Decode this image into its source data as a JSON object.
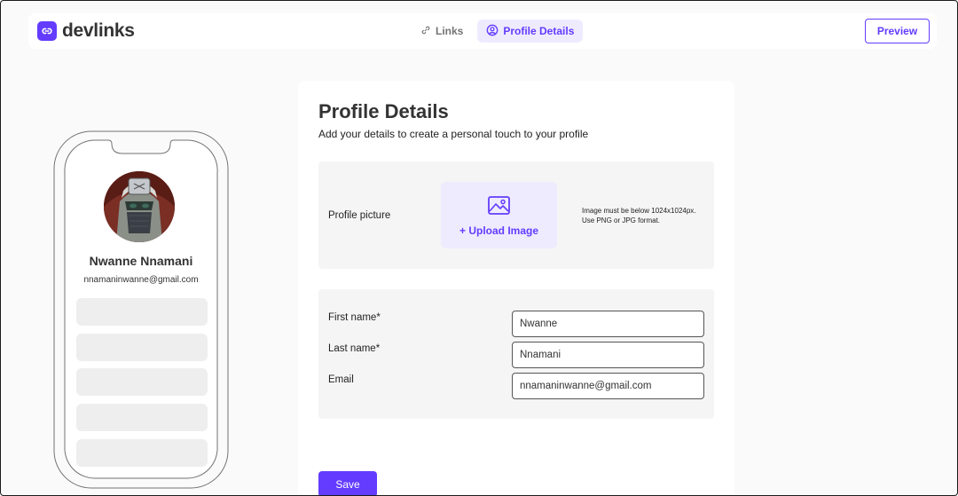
{
  "app": {
    "name": "devlinks",
    "accent": "#633cff",
    "accent_light": "#efebff"
  },
  "nav": {
    "tabs": [
      {
        "label": "Links",
        "icon": "link-icon",
        "active": false
      },
      {
        "label": "Profile Details",
        "icon": "user-circle-icon",
        "active": true
      }
    ],
    "preview_label": "Preview"
  },
  "phone_preview": {
    "name": "Nwanne Nnamani",
    "email": "nnamaninwanne@gmail.com",
    "link_placeholders": 5
  },
  "profile": {
    "title": "Profile Details",
    "subtitle": "Add your details to create a personal touch to your profile",
    "picture": {
      "label": "Profile picture",
      "upload_label": "+ Upload Image",
      "note_line1": "Image must be below 1024x1024px.",
      "note_line2": "Use PNG or JPG format."
    },
    "fields": [
      {
        "label": "First name*",
        "value": "Nwanne"
      },
      {
        "label": "Last name*",
        "value": "Nnamani"
      },
      {
        "label": "Email",
        "value": "nnamaninwanne@gmail.com"
      }
    ],
    "save_label": "Save"
  }
}
